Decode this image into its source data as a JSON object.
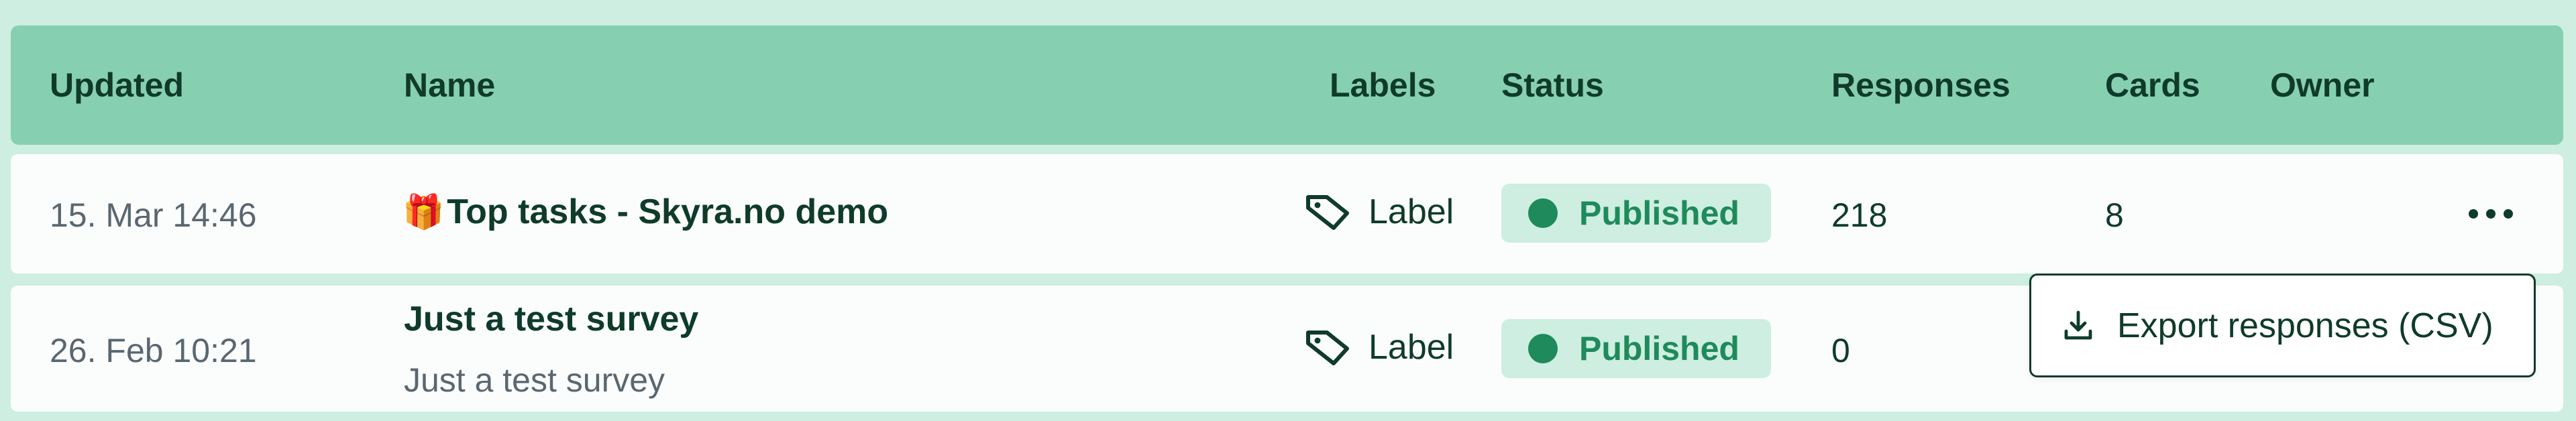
{
  "table": {
    "headers": {
      "updated": "Updated",
      "name": "Name",
      "labels": "Labels",
      "status": "Status",
      "responses": "Responses",
      "cards": "Cards",
      "owner": "Owner"
    },
    "rows": [
      {
        "updated": "15. Mar 14:46",
        "name_emoji": "🎁",
        "name": "Top tasks - Skyra.no demo",
        "label": "Label",
        "status": "Published",
        "responses": "218",
        "cards": "8"
      },
      {
        "updated": "26. Feb 10:21",
        "name": "Just a test survey",
        "subtitle": "Just a test survey",
        "label": "Label",
        "status": "Published",
        "responses": "0"
      }
    ]
  },
  "menu": {
    "export_label": "Export responses (CSV)"
  },
  "colors": {
    "background": "#cdeee0",
    "header": "#86d0b1",
    "accent": "#1f8a5b",
    "text": "#0f3b2a"
  },
  "icons": {
    "label": "tag-icon",
    "more": "more-horizontal-icon",
    "export": "download-icon"
  }
}
